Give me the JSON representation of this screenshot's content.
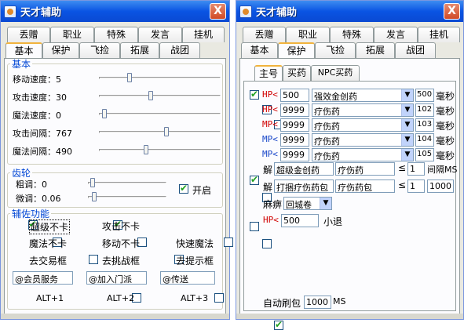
{
  "win1": {
    "title": "天才辅助",
    "close": "X",
    "tabs_row1": [
      "丢赠",
      "职业",
      "特殊",
      "发言",
      "挂机"
    ],
    "tabs_row2": [
      "基本",
      "保护",
      "飞捡",
      "拓展",
      "战团"
    ],
    "basic": {
      "legend": "基本",
      "sliders": [
        {
          "label": "移动速度：5",
          "value": 0.24
        },
        {
          "label": "攻击速度：30",
          "value": 0.42
        },
        {
          "label": "魔法速度：0",
          "value": 0.03
        },
        {
          "label": "攻击间隔：767",
          "value": 0.56
        },
        {
          "label": "魔法间隔：490",
          "value": 0.38
        }
      ]
    },
    "gear": {
      "legend": "齿轮",
      "rough": {
        "label": "粗调：0",
        "value": 0.03
      },
      "fine": {
        "label": "微调：0.06",
        "value": 0.05
      },
      "enable": {
        "label": "开启",
        "checked": true
      }
    },
    "assist": {
      "legend": "辅佐功能",
      "checks": [
        {
          "label": "超级不卡",
          "checked": true
        },
        {
          "label": "攻击不卡",
          "checked": true
        },
        {
          "label": "魔法不卡",
          "checked": false
        },
        {
          "label": "移动不卡",
          "checked": false
        },
        {
          "label": "快速魔法",
          "checked": false
        },
        {
          "label": "去交易框",
          "checked": false
        },
        {
          "label": "去挑战框",
          "checked": false
        },
        {
          "label": "去提示框",
          "checked": false
        }
      ],
      "inputs": [
        "@会员服务",
        "@加入门派",
        "@传送"
      ],
      "hotkeys": [
        "ALT+1",
        "ALT+2",
        "ALT+3"
      ]
    }
  },
  "win2": {
    "title": "天才辅助",
    "close": "X",
    "tabs_row1": [
      "丢赠",
      "职业",
      "特殊",
      "发言",
      "挂机"
    ],
    "tabs_row2": [
      "基本",
      "保护",
      "飞捡",
      "拓展",
      "战团"
    ],
    "subtabs": [
      "主号",
      "买药",
      "NPC买药"
    ],
    "potion_rows": [
      {
        "prefix": "HP<",
        "color": "#d00000",
        "checked": true,
        "value": "500",
        "item": "强效金创药",
        "num": "500",
        "unit": "毫秒"
      },
      {
        "prefix": "HP<",
        "color": "#d00000",
        "checked": false,
        "value": "9999",
        "item": "疗伤药",
        "num": "102",
        "unit": "毫秒"
      },
      {
        "prefix": "MP<",
        "color": "#d00000",
        "checked": false,
        "value": "9999",
        "item": "疗伤药",
        "num": "103",
        "unit": "毫秒"
      },
      {
        "prefix": "MP<",
        "color": "#1846c9",
        "checked": false,
        "value": "9999",
        "item": "疗伤药",
        "num": "104",
        "unit": "毫秒"
      },
      {
        "prefix": "MP<",
        "color": "#1846c9",
        "checked": false,
        "value": "9999",
        "item": "疗伤药",
        "num": "105",
        "unit": "毫秒"
      }
    ],
    "unpack_rows": [
      {
        "checked": true,
        "prefix": "解",
        "a": "超级金创药",
        "b": "疗伤药",
        "le": "≤",
        "n": "1",
        "tail": "间隔MS"
      },
      {
        "checked": false,
        "prefix": "解",
        "a": "打捆疗伤药包",
        "b": "疗伤药包",
        "le": "≤",
        "n": "1",
        "tail": "1000"
      }
    ],
    "paralysis": {
      "checked": false,
      "label": "麻痹",
      "item": "回城卷"
    },
    "retreat": {
      "checked": false,
      "prefix": "HP<",
      "value": "500",
      "label": "小退"
    },
    "auto_refresh": {
      "checked": true,
      "label": "自动刷包",
      "value": "1000",
      "unit": "MS"
    },
    "colors": {
      "accent": "#0a54e3",
      "legend": "#0046d5",
      "hp": "#d00000",
      "mp": "#1846c9"
    }
  }
}
